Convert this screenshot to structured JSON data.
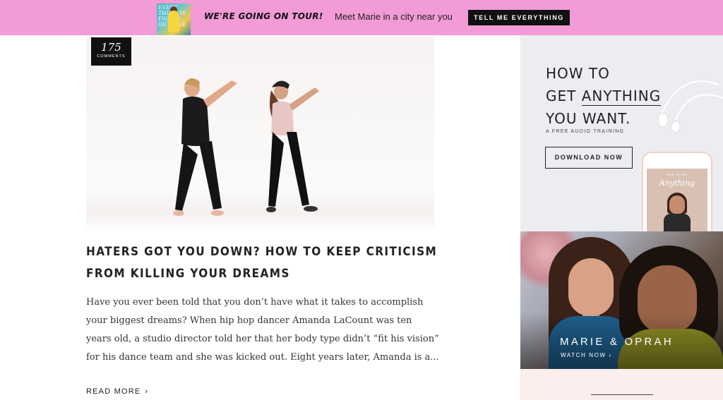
{
  "banner": {
    "book_title": "EVERY THING IS FIGURE-OUTABLE",
    "headline": "WE'RE GOING ON TOUR!",
    "message": "Meet Marie in a city near you",
    "cta_label": "TELL ME EVERYTHING",
    "background_color": "#f29bd6"
  },
  "article": {
    "comment_count": "175",
    "comment_label": "COMMENTS",
    "title": "HATERS GOT YOU DOWN? HOW TO KEEP CRITICISM FROM KILLING YOUR DREAMS",
    "excerpt": "Have you ever been told that you don’t have what it takes to accomplish your biggest dreams? When hip hop dancer Amanda LaCount was ten years old, a studio director told her that her body type didn’t “fit his vision” for his dance team and she was kicked out.  Eight years later, Amanda is a...",
    "read_more": "READ MORE"
  },
  "sidebar": {
    "ad": {
      "line1": "HOW TO",
      "line2a": "GET ",
      "line2b": "ANYTHING",
      "line3": "YOU WANT.",
      "subtitle": "A FREE AUDIO TRAINING",
      "button_label": "DOWNLOAD NOW",
      "phone_title": "HOW TO GET",
      "phone_script": "Anything"
    },
    "video": {
      "title": "MARIE & OPRAH",
      "watch_label": "WATCH NOW"
    }
  },
  "icons": {
    "chevron": "›"
  }
}
